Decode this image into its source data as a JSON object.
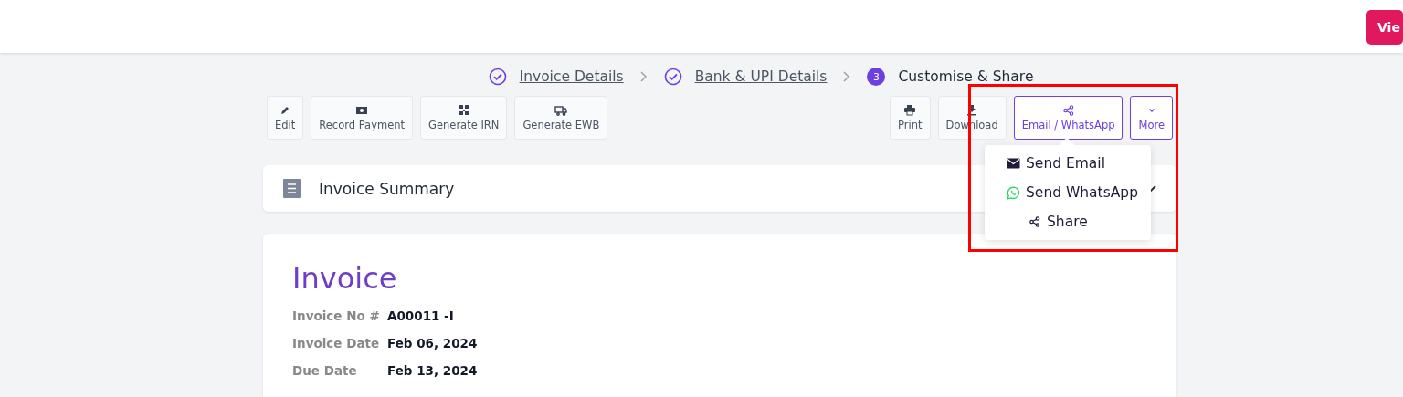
{
  "header": {
    "button": "Vie"
  },
  "steps": [
    {
      "label": "Invoice Details",
      "kind": "done"
    },
    {
      "label": "Bank & UPI Details",
      "kind": "done"
    },
    {
      "label": "Customise & Share",
      "kind": "current",
      "number": "3"
    }
  ],
  "left_actions": [
    {
      "label": "Edit"
    },
    {
      "label": "Record Payment"
    },
    {
      "label": "Generate IRN"
    },
    {
      "label": "Generate EWB"
    }
  ],
  "right_actions": [
    {
      "label": "Print",
      "selected": false
    },
    {
      "label": "Download",
      "selected": false
    },
    {
      "label": "Email / WhatsApp",
      "selected": true
    },
    {
      "label": "More",
      "selected": true
    }
  ],
  "share_menu": [
    {
      "label": "Send Email"
    },
    {
      "label": "Send WhatsApp"
    },
    {
      "label": "Share"
    }
  ],
  "summary": {
    "title": "Invoice Summary",
    "expanded": false
  },
  "invoice": {
    "title": "Invoice",
    "fields": [
      {
        "label": "Invoice No #",
        "value": "A00011 -I"
      },
      {
        "label": "Invoice Date",
        "value": "Feb 06, 2024"
      },
      {
        "label": "Due Date",
        "value": "Feb 13, 2024"
      }
    ]
  }
}
